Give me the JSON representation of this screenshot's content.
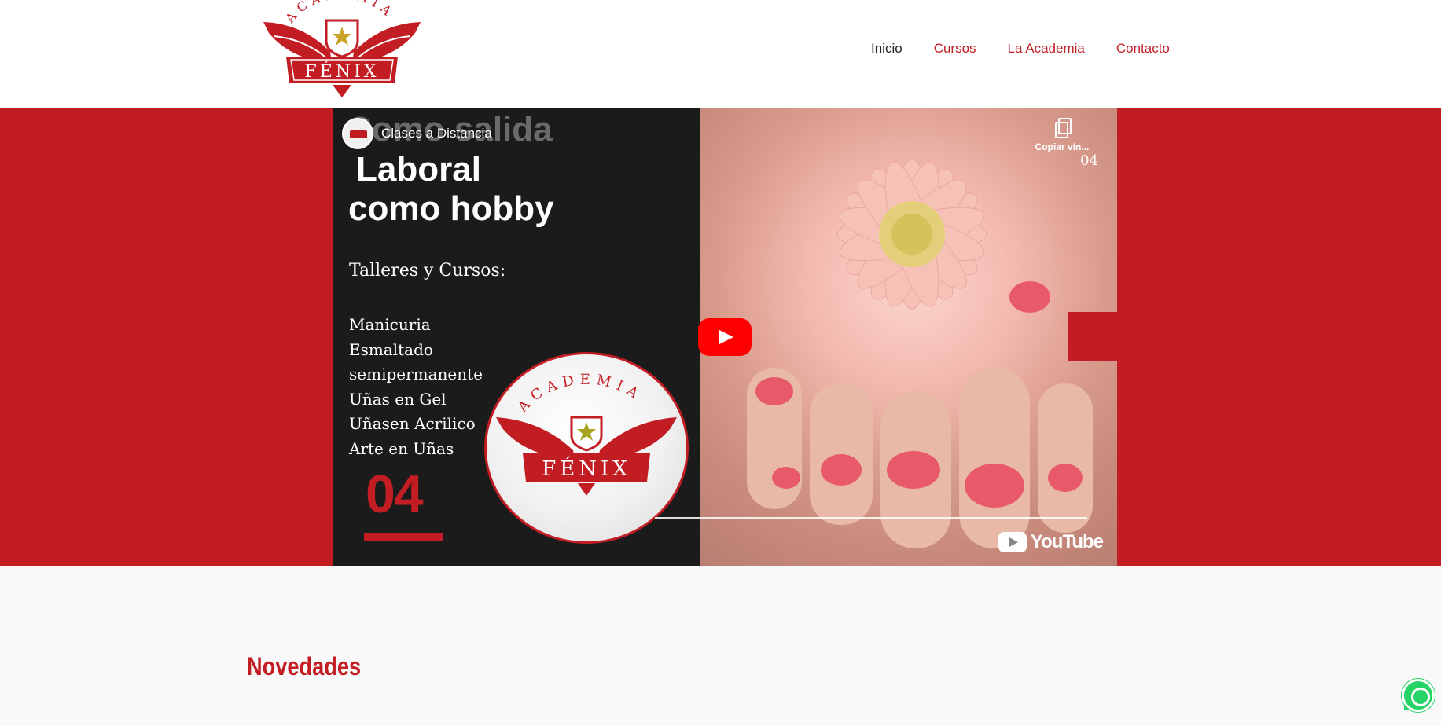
{
  "header": {
    "logo_top": "ACADEMIA",
    "logo_main": "FÉNIX",
    "nav": [
      {
        "label": "Inicio",
        "active": true
      },
      {
        "label": "Cursos",
        "active": false
      },
      {
        "label": "La Academia",
        "active": false
      },
      {
        "label": "Contacto",
        "active": false
      }
    ]
  },
  "colors": {
    "brand_red": "#c31d24",
    "nav_active": "#222222",
    "youtube_red": "#ff0000",
    "whatsapp_green": "#25d366"
  },
  "video": {
    "channel_name": "Clases a Distancia",
    "copy_link_label": "Copiar vín...",
    "counter_small": "04",
    "ghost_title": "Como salida",
    "headline_line1": "Laboral",
    "headline_line2": "como hobby",
    "subtitle": "Talleres y Cursos:",
    "courses": [
      "Manicuria",
      "Esmaltado",
      "semipermanente",
      "Uñas en Gel",
      "Uñasen Acrilico",
      "Arte en Uñas"
    ],
    "number": "04",
    "badge_top": "ACADEMIA",
    "badge_main": "FÉNIX",
    "youtube_label": "YouTube"
  },
  "sections": {
    "novedades_title": "Novedades"
  },
  "icons": {
    "play": "play-icon",
    "copy": "copy-link-icon",
    "youtube": "youtube-logo-icon",
    "whatsapp": "whatsapp-icon"
  }
}
